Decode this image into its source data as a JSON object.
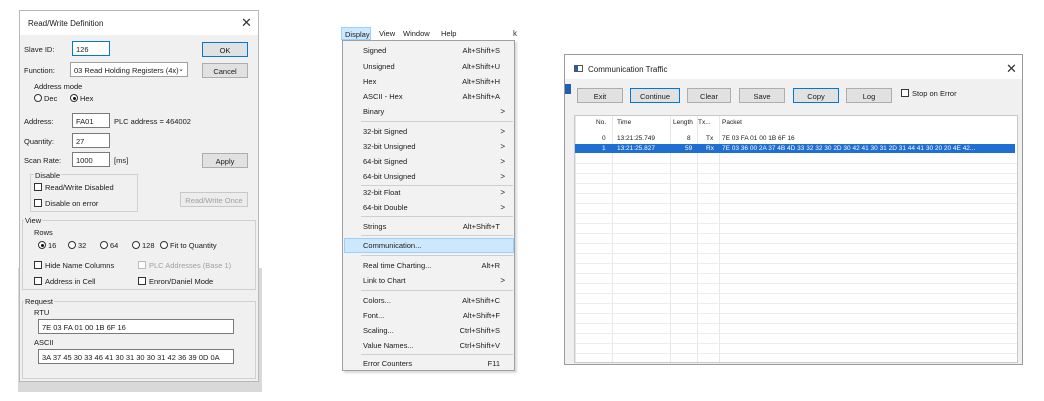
{
  "rw_dialog": {
    "title": "Read/Write Definition",
    "close_glyph": "✕",
    "slave_id_label": "Slave ID:",
    "slave_id_value": "126",
    "ok_label": "OK",
    "function_label": "Function:",
    "function_value": "03 Read Holding Registers (4x)",
    "cancel_label": "Cancel",
    "address_mode_label": "Address mode",
    "dec_label": "Dec",
    "hex_label": "Hex",
    "address_label": "Address:",
    "address_value": "FA01",
    "plc_address_text": "PLC address = 464002",
    "quantity_label": "Quantity:",
    "quantity_value": "27",
    "scan_rate_label": "Scan Rate:",
    "scan_rate_value": "1000",
    "scan_rate_unit": "[ms]",
    "apply_label": "Apply",
    "disable_label": "Disable",
    "rw_disabled_label": "Read/Write Disabled",
    "disable_on_error_label": "Disable on error",
    "rw_once_label": "Read/Write Once",
    "view_label": "View",
    "rows_label": "Rows",
    "rows_options": [
      "16",
      "32",
      "64",
      "128",
      "Fit to Quantity"
    ],
    "hide_name_columns_label": "Hide Name Columns",
    "plc_addresses_label": "PLC Addresses (Base 1)",
    "address_in_cell_label": "Address in Cell",
    "enron_label": "Enron/Daniel Mode",
    "request_label": "Request",
    "rtu_label": "RTU",
    "rtu_value": "7E 03 FA 01 00 1B 6F 16",
    "ascii_label": "ASCII",
    "ascii_value": "3A 37 45 30 33 46 41 30 31 30 30 31 42 36 39 0D 0A"
  },
  "menubar": {
    "items": [
      "Display",
      "View",
      "Window",
      "Help"
    ]
  },
  "display_menu": {
    "items": [
      {
        "label": "Signed",
        "shortcut": "Alt+Shift+S"
      },
      {
        "label": "Unsigned",
        "shortcut": "Alt+Shift+U"
      },
      {
        "label": "Hex",
        "shortcut": "Alt+Shift+H"
      },
      {
        "label": "ASCII - Hex",
        "shortcut": "Alt+Shift+A"
      },
      {
        "label": "Binary",
        "shortcut": ""
      },
      {
        "label": "32-bit Signed",
        "shortcut": ""
      },
      {
        "label": "32-bit Unsigned",
        "shortcut": ""
      },
      {
        "label": "64-bit Signed",
        "shortcut": ""
      },
      {
        "label": "64-bit Unsigned",
        "shortcut": ""
      },
      {
        "label": "32-bit Float",
        "shortcut": ""
      },
      {
        "label": "64-bit Double",
        "shortcut": ""
      },
      {
        "label": "Strings",
        "shortcut": "Alt+Shift+T"
      },
      {
        "label": "Communication...",
        "shortcut": ""
      },
      {
        "label": "Real time Charting...",
        "shortcut": "Alt+R"
      },
      {
        "label": "Link to Chart",
        "shortcut": ""
      },
      {
        "label": "Colors...",
        "shortcut": "Alt+Shift+C"
      },
      {
        "label": "Font...",
        "shortcut": "Alt+Shift+F"
      },
      {
        "label": "Scaling...",
        "shortcut": "Ctrl+Shift+S"
      },
      {
        "label": "Value Names...",
        "shortcut": "Ctrl+Shift+V"
      },
      {
        "label": "Error Counters",
        "shortcut": "F11"
      }
    ],
    "submenu_glyph": ">"
  },
  "traffic": {
    "title": "Communication Traffic",
    "close_glyph": "✕",
    "buttons": [
      "Exit",
      "Continue",
      "Clear",
      "Save",
      "Copy",
      "Log"
    ],
    "stop_on_error_label": "Stop on Error",
    "columns": [
      "No.",
      "Time",
      "Length",
      "Tx...",
      "Packet"
    ],
    "rows": [
      {
        "no": "0",
        "time": "13:21:25.749",
        "length": "8",
        "dir": "Tx",
        "packet": "7E 03 FA 01 00 1B 6F 16"
      },
      {
        "no": "1",
        "time": "13:21:25.827",
        "length": "59",
        "dir": "Rx",
        "packet": "7E 03 36 00 2A 37 4B 4D 33 32 32 30 2D 30 42 41 30 31 2D 31 44 41 30 20 20 4E 42..."
      }
    ]
  },
  "colors": {
    "accent": "#0078d7",
    "selection": "#1e6fd1",
    "menu_highlight": "#cce8ff"
  }
}
